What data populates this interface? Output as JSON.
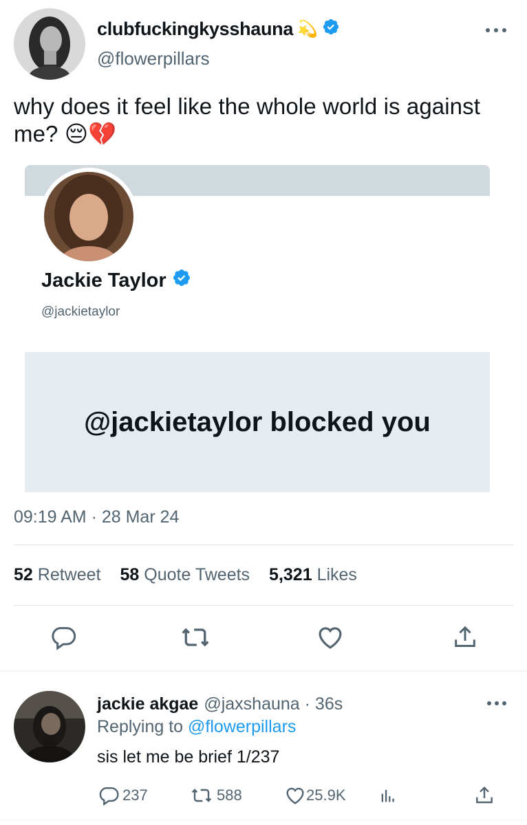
{
  "tweet": {
    "display_name": "clubfuckingkysshauna",
    "name_emoji": "💫",
    "handle": "@flowerpillars",
    "text": "why does it feel like the whole world is against me? 😔💔",
    "timestamp": "09:19 AM · 28 Mar 24",
    "stats": {
      "retweets_count": "52",
      "retweets_label": "Retweet",
      "quotes_count": "58",
      "quotes_label": "Quote Tweets",
      "likes_count": "5,321",
      "likes_label": "Likes"
    },
    "icons": [
      "reply-icon",
      "retweet-icon",
      "like-icon",
      "share-icon",
      "more-icon",
      "verified-badge-icon"
    ]
  },
  "embed": {
    "name": "Jackie Taylor",
    "handle": "@jackietaylor",
    "blocked_text": "@jackietaylor blocked you"
  },
  "reply": {
    "name": "jackie akgae",
    "handle_time": "@jaxshauna · 36s",
    "replying_prefix": "Replying to",
    "replying_mention": "@flowerpillars",
    "text": "sis let me be brief 1/237",
    "reply_count": "237",
    "retweet_count": "588",
    "like_count": "25.9K"
  },
  "colors": {
    "verified": "#1d9bf0",
    "secondary_text": "#536471",
    "link": "#1d9bf0",
    "banner": "#cfd9de",
    "blocked_box": "#e7ecf0"
  }
}
